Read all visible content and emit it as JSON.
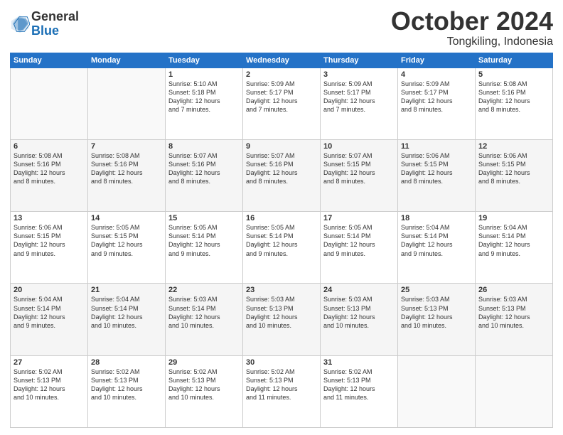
{
  "logo": {
    "line1": "General",
    "line2": "Blue"
  },
  "title": "October 2024",
  "subtitle": "Tongkiling, Indonesia",
  "days_of_week": [
    "Sunday",
    "Monday",
    "Tuesday",
    "Wednesday",
    "Thursday",
    "Friday",
    "Saturday"
  ],
  "weeks": [
    [
      {
        "day": "",
        "info": ""
      },
      {
        "day": "",
        "info": ""
      },
      {
        "day": "1",
        "sunrise": "5:10 AM",
        "sunset": "5:18 PM",
        "daylight": "12 hours and 7 minutes."
      },
      {
        "day": "2",
        "sunrise": "5:09 AM",
        "sunset": "5:17 PM",
        "daylight": "12 hours and 7 minutes."
      },
      {
        "day": "3",
        "sunrise": "5:09 AM",
        "sunset": "5:17 PM",
        "daylight": "12 hours and 7 minutes."
      },
      {
        "day": "4",
        "sunrise": "5:09 AM",
        "sunset": "5:17 PM",
        "daylight": "12 hours and 8 minutes."
      },
      {
        "day": "5",
        "sunrise": "5:08 AM",
        "sunset": "5:16 PM",
        "daylight": "12 hours and 8 minutes."
      }
    ],
    [
      {
        "day": "6",
        "sunrise": "5:08 AM",
        "sunset": "5:16 PM",
        "daylight": "12 hours and 8 minutes."
      },
      {
        "day": "7",
        "sunrise": "5:08 AM",
        "sunset": "5:16 PM",
        "daylight": "12 hours and 8 minutes."
      },
      {
        "day": "8",
        "sunrise": "5:07 AM",
        "sunset": "5:16 PM",
        "daylight": "12 hours and 8 minutes."
      },
      {
        "day": "9",
        "sunrise": "5:07 AM",
        "sunset": "5:16 PM",
        "daylight": "12 hours and 8 minutes."
      },
      {
        "day": "10",
        "sunrise": "5:07 AM",
        "sunset": "5:15 PM",
        "daylight": "12 hours and 8 minutes."
      },
      {
        "day": "11",
        "sunrise": "5:06 AM",
        "sunset": "5:15 PM",
        "daylight": "12 hours and 8 minutes."
      },
      {
        "day": "12",
        "sunrise": "5:06 AM",
        "sunset": "5:15 PM",
        "daylight": "12 hours and 8 minutes."
      }
    ],
    [
      {
        "day": "13",
        "sunrise": "5:06 AM",
        "sunset": "5:15 PM",
        "daylight": "12 hours and 9 minutes."
      },
      {
        "day": "14",
        "sunrise": "5:05 AM",
        "sunset": "5:15 PM",
        "daylight": "12 hours and 9 minutes."
      },
      {
        "day": "15",
        "sunrise": "5:05 AM",
        "sunset": "5:14 PM",
        "daylight": "12 hours and 9 minutes."
      },
      {
        "day": "16",
        "sunrise": "5:05 AM",
        "sunset": "5:14 PM",
        "daylight": "12 hours and 9 minutes."
      },
      {
        "day": "17",
        "sunrise": "5:05 AM",
        "sunset": "5:14 PM",
        "daylight": "12 hours and 9 minutes."
      },
      {
        "day": "18",
        "sunrise": "5:04 AM",
        "sunset": "5:14 PM",
        "daylight": "12 hours and 9 minutes."
      },
      {
        "day": "19",
        "sunrise": "5:04 AM",
        "sunset": "5:14 PM",
        "daylight": "12 hours and 9 minutes."
      }
    ],
    [
      {
        "day": "20",
        "sunrise": "5:04 AM",
        "sunset": "5:14 PM",
        "daylight": "12 hours and 9 minutes."
      },
      {
        "day": "21",
        "sunrise": "5:04 AM",
        "sunset": "5:14 PM",
        "daylight": "12 hours and 10 minutes."
      },
      {
        "day": "22",
        "sunrise": "5:03 AM",
        "sunset": "5:14 PM",
        "daylight": "12 hours and 10 minutes."
      },
      {
        "day": "23",
        "sunrise": "5:03 AM",
        "sunset": "5:13 PM",
        "daylight": "12 hours and 10 minutes."
      },
      {
        "day": "24",
        "sunrise": "5:03 AM",
        "sunset": "5:13 PM",
        "daylight": "12 hours and 10 minutes."
      },
      {
        "day": "25",
        "sunrise": "5:03 AM",
        "sunset": "5:13 PM",
        "daylight": "12 hours and 10 minutes."
      },
      {
        "day": "26",
        "sunrise": "5:03 AM",
        "sunset": "5:13 PM",
        "daylight": "12 hours and 10 minutes."
      }
    ],
    [
      {
        "day": "27",
        "sunrise": "5:02 AM",
        "sunset": "5:13 PM",
        "daylight": "12 hours and 10 minutes."
      },
      {
        "day": "28",
        "sunrise": "5:02 AM",
        "sunset": "5:13 PM",
        "daylight": "12 hours and 10 minutes."
      },
      {
        "day": "29",
        "sunrise": "5:02 AM",
        "sunset": "5:13 PM",
        "daylight": "12 hours and 10 minutes."
      },
      {
        "day": "30",
        "sunrise": "5:02 AM",
        "sunset": "5:13 PM",
        "daylight": "12 hours and 11 minutes."
      },
      {
        "day": "31",
        "sunrise": "5:02 AM",
        "sunset": "5:13 PM",
        "daylight": "12 hours and 11 minutes."
      },
      {
        "day": "",
        "info": ""
      },
      {
        "day": "",
        "info": ""
      }
    ]
  ]
}
